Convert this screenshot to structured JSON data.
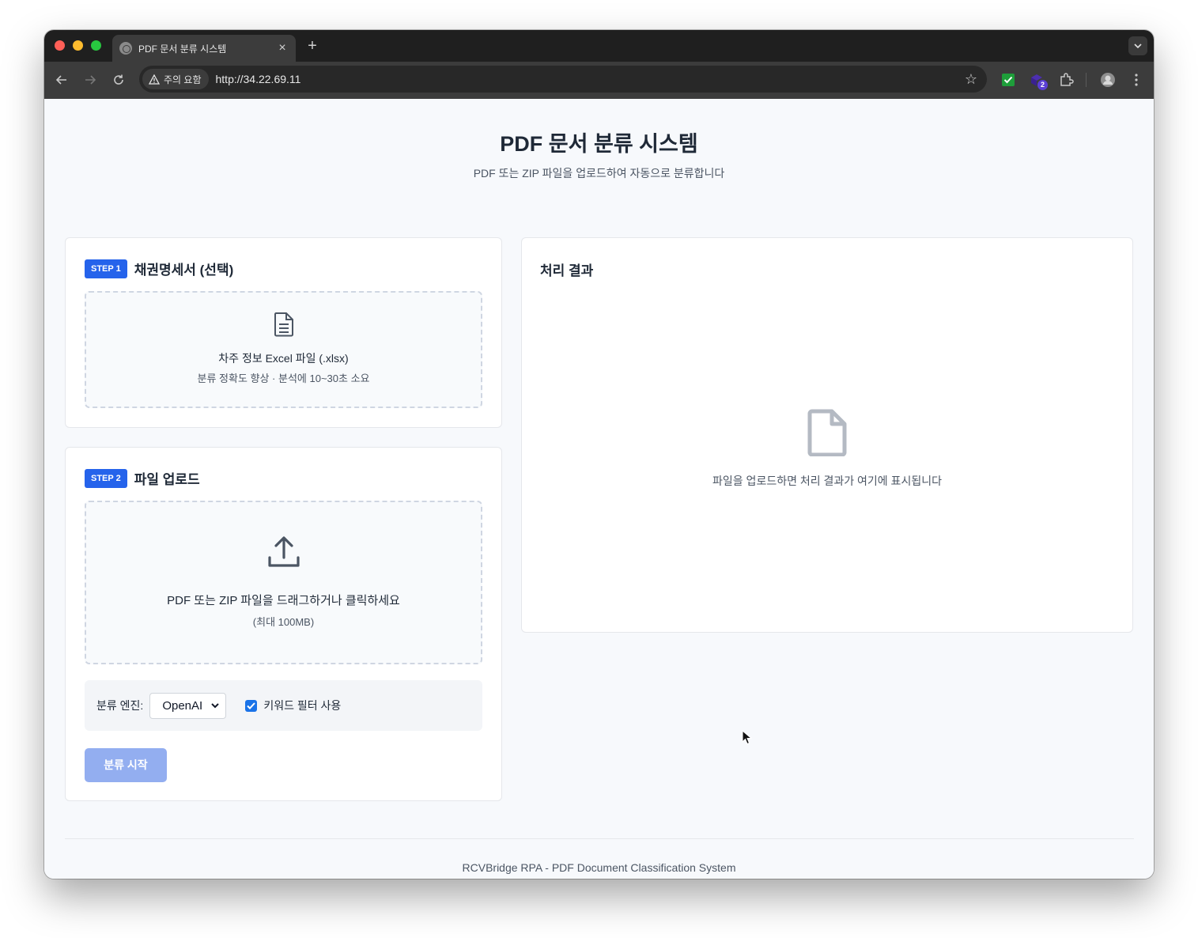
{
  "browser": {
    "tab_title": "PDF 문서 분류 시스템",
    "tab_close": "×",
    "new_tab": "+",
    "security_label": "주의 요함",
    "url": "http://34.22.69.11",
    "extension_badge": "2"
  },
  "header": {
    "title": "PDF 문서 분류 시스템",
    "subtitle": "PDF 또는 ZIP 파일을 업로드하여 자동으로 분류합니다"
  },
  "step1": {
    "badge": "STEP 1",
    "title": "채권명세서 (선택)",
    "dropzone_title": "차주 정보 Excel 파일 (.xlsx)",
    "dropzone_hint": "분류 정확도 향상 · 분석에 10~30초 소요"
  },
  "step2": {
    "badge": "STEP 2",
    "title": "파일 업로드",
    "dropzone_title": "PDF 또는 ZIP 파일을 드래그하거나 클릭하세요",
    "dropzone_hint": "(최대 100MB)",
    "engine_label": "분류 엔진:",
    "engine_value": "OpenAI",
    "keyword_filter_label": "키워드 필터 사용",
    "keyword_filter_checked": true,
    "start_button": "분류 시작"
  },
  "result": {
    "title": "처리 결과",
    "empty_message": "파일을 업로드하면 처리 결과가 여기에 표시됩니다"
  },
  "footer": {
    "text": "RCVBridge RPA - PDF Document Classification System"
  },
  "colors": {
    "accent": "#2563eb",
    "button_disabled": "#93aef0",
    "page_bg": "#f7f9fc"
  }
}
